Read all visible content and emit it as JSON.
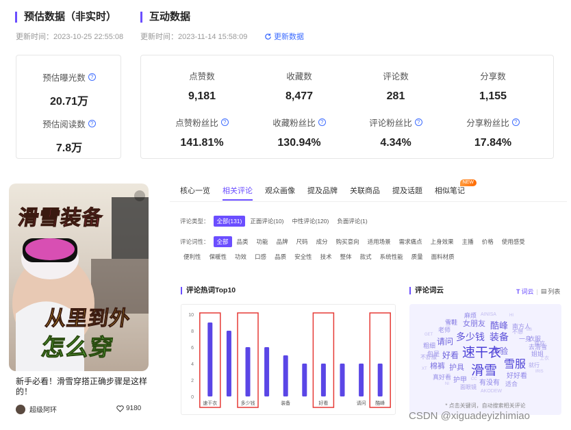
{
  "estimate": {
    "title": "预估数据（非实时）",
    "update_time": "更新时间：2023-10-25 22:55:08",
    "metrics": [
      {
        "label": "预估曝光数",
        "value": "20.71万"
      },
      {
        "label": "预估阅读数",
        "value": "7.8万"
      }
    ]
  },
  "interaction": {
    "title": "互动数据",
    "update_time": "更新时间：2023-11-14 15:58:09",
    "refresh_label": "更新数据",
    "metrics_top": [
      {
        "label": "点赞数",
        "value": "9,181"
      },
      {
        "label": "收藏数",
        "value": "8,477"
      },
      {
        "label": "评论数",
        "value": "281"
      },
      {
        "label": "分享数",
        "value": "1,155"
      }
    ],
    "metrics_bottom": [
      {
        "label": "点赞粉丝比",
        "value": "141.81%"
      },
      {
        "label": "收藏粉丝比",
        "value": "130.94%"
      },
      {
        "label": "评论粉丝比",
        "value": "4.34%"
      },
      {
        "label": "分享粉丝比",
        "value": "17.84%"
      }
    ]
  },
  "post": {
    "cover_text_top": "滑雪装备",
    "cover_text_mid": "从里到外",
    "cover_text_bottom": "怎么穿",
    "title": "新手必看！滑雪穿搭正确步骤是这样的！",
    "author": "超级阿环",
    "likes": "9180"
  },
  "tabs": [
    {
      "label": "核心一览",
      "active": false
    },
    {
      "label": "相关评论",
      "active": true
    },
    {
      "label": "观众画像",
      "active": false
    },
    {
      "label": "提及品牌",
      "active": false
    },
    {
      "label": "关联商品",
      "active": false
    },
    {
      "label": "提及话题",
      "active": false
    },
    {
      "label": "相似笔记",
      "active": false,
      "badge": "NEW"
    }
  ],
  "filters": {
    "type_label": "评论类型：",
    "types": [
      {
        "label": "全部(131)",
        "active": true
      },
      {
        "label": "正面评论(10)",
        "active": false
      },
      {
        "label": "中性评论(120)",
        "active": false
      },
      {
        "label": "负面评论(1)",
        "active": false
      }
    ],
    "word_label": "评论词性：",
    "words": [
      "全部",
      "品类",
      "功能",
      "品牌",
      "尺码",
      "成分",
      "购买意向",
      "适用场景",
      "需求痛点",
      "上身效果",
      "主播",
      "价格",
      "使用感受",
      "便利性",
      "保暖性",
      "功效",
      "口感",
      "品质",
      "安全性",
      "技术",
      "整体",
      "款式",
      "系统性能",
      "质量",
      "面料材质"
    ]
  },
  "hotwords": {
    "title": "评论热词Top10"
  },
  "wordcloud": {
    "title": "评论词云",
    "view_cloud": "词云",
    "view_list": "列表",
    "note": "* 点击关键词，自动搜索相关评论",
    "words": [
      {
        "text": "麻烦",
        "size": 9,
        "color": "#8f86e8"
      },
      {
        "text": "AINISA",
        "size": 7,
        "color": "#c3bdf0"
      },
      {
        "text": "HI",
        "size": 6,
        "color": "#c3bdf0"
      },
      {
        "text": "雪鞋",
        "size": 9,
        "color": "#7d72e0"
      },
      {
        "text": "女朋友",
        "size": 11,
        "color": "#7d72e0"
      },
      {
        "text": "酷峰",
        "size": 13,
        "color": "#6b5fdc"
      },
      {
        "text": "南方人",
        "size": 9,
        "color": "#9a92e8"
      },
      {
        "text": "老师",
        "size": 9,
        "color": "#9a92e8"
      },
      {
        "text": "不想",
        "size": 8,
        "color": "#a9a2ea"
      },
      {
        "text": "BB",
        "size": 6,
        "color": "#c3bdf0"
      },
      {
        "text": "GET",
        "size": 6,
        "color": "#c3bdf0"
      },
      {
        "text": "多少钱",
        "size": 14,
        "color": "#5b4fd8"
      },
      {
        "text": "装备",
        "size": 14,
        "color": "#5b4fd8"
      },
      {
        "text": "一身",
        "size": 9,
        "color": "#9a92e8"
      },
      {
        "text": "衣服",
        "size": 9,
        "color": "#9a92e8"
      },
      {
        "text": "请问",
        "size": 12,
        "color": "#6b5fdc"
      },
      {
        "text": "喜欢",
        "size": 8,
        "color": "#a9a2ea"
      },
      {
        "text": "去滑雪",
        "size": 9,
        "color": "#9a92e8"
      },
      {
        "text": "粗细",
        "size": 9,
        "color": "#9a92e8"
      },
      {
        "text": "包是",
        "size": 9,
        "color": "#9a92e8"
      },
      {
        "text": "好看",
        "size": 12,
        "color": "#6b5fdc"
      },
      {
        "text": "速干衣",
        "size": 19,
        "color": "#4a3fd6"
      },
      {
        "text": "体验",
        "size": 12,
        "color": "#6b5fdc"
      },
      {
        "text": "姐姐",
        "size": 9,
        "color": "#9a92e8"
      },
      {
        "text": "不舒服",
        "size": 8,
        "color": "#a9a2ea"
      },
      {
        "text": "雪服",
        "size": 16,
        "color": "#5045d6"
      },
      {
        "text": "上衣",
        "size": 7,
        "color": "#c3bdf0"
      },
      {
        "text": "就行",
        "size": 8,
        "color": "#a9a2ea"
      },
      {
        "text": "棉裤",
        "size": 11,
        "color": "#7d72e0"
      },
      {
        "text": "护具",
        "size": 11,
        "color": "#7d72e0"
      },
      {
        "text": "滑雪",
        "size": 19,
        "color": "#4a3fd6"
      },
      {
        "text": "IRIS",
        "size": 6,
        "color": "#c3bdf0"
      },
      {
        "text": "XT",
        "size": 6,
        "color": "#c3bdf0"
      },
      {
        "text": "好好看",
        "size": 10,
        "color": "#8f86e8"
      },
      {
        "text": "真好看",
        "size": 9,
        "color": "#9a92e8"
      },
      {
        "text": "护甲",
        "size": 10,
        "color": "#8f86e8"
      },
      {
        "text": "CC",
        "size": 6,
        "color": "#c3bdf0"
      },
      {
        "text": "有没有",
        "size": 10,
        "color": "#8f86e8"
      },
      {
        "text": "适合",
        "size": 9,
        "color": "#9a92e8"
      },
      {
        "text": "NI",
        "size": 6,
        "color": "#c3bdf0"
      },
      {
        "text": "面眼镜",
        "size": 8,
        "color": "#a9a2ea"
      },
      {
        "text": "AKODEW",
        "size": 7,
        "color": "#c3bdf0"
      }
    ]
  },
  "chart_data": {
    "type": "bar",
    "categories": [
      "速干衣",
      "",
      "多少钱",
      "",
      "装备",
      "",
      "好看",
      "",
      "请问",
      "酷峰"
    ],
    "values": [
      9,
      8,
      6,
      6,
      5,
      4,
      4,
      4,
      4,
      4
    ],
    "highlighted": [
      0,
      2,
      6,
      9
    ],
    "yticks": [
      0,
      2,
      4,
      6,
      8,
      10
    ],
    "ylim": [
      0,
      10
    ],
    "bar_color": "#5a46e6",
    "highlight_color": "#e53935"
  },
  "watermark": "CSDN @xiguadeyizhimiao"
}
